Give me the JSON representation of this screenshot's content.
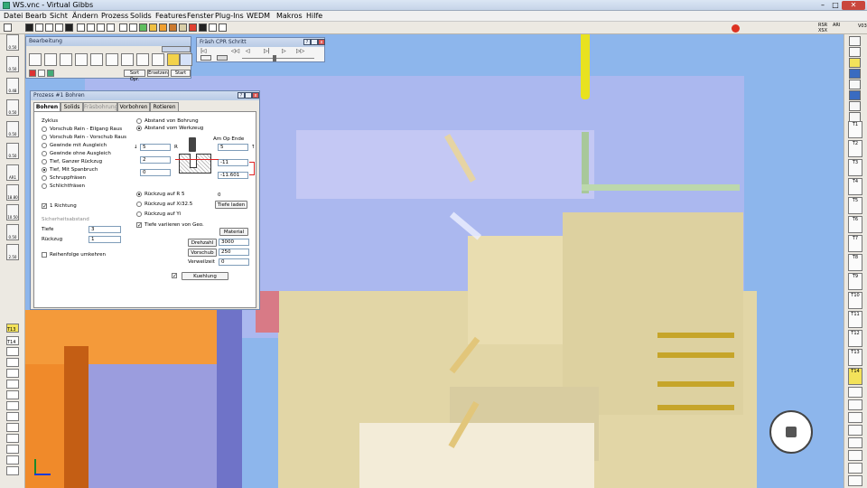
{
  "window": {
    "title": "WS.vnc - Virtual Gibbs",
    "minimize": "–",
    "maximize": "□",
    "close": "✕"
  },
  "menu": [
    "Datei",
    "Bearb",
    "Sicht",
    "Ändern",
    "Prozess",
    "Solids",
    "Features",
    "Fenster",
    "Plug-Ins",
    "WEDM",
    "Makros",
    "Hilfe"
  ],
  "toolbar": {
    "rsr": "RSR\nXSX",
    "arl": "ARI",
    "v": "V03"
  },
  "bearbeitung": {
    "title": "Bearbeitung",
    "buttons": [
      "Sort Opr.",
      "Ersetzen",
      "Start"
    ]
  },
  "cpr": {
    "title": "Fräsh CPR Schritt"
  },
  "prozess": {
    "title": "Prozess #1 Bohren",
    "tabs": [
      "Bohren",
      "Solids",
      "Fräsbohrung",
      "Vorbohren",
      "Rotieren"
    ],
    "zyklus_label": "Zyklus",
    "zyklus": [
      "Vorschub Rein - Eilgang Raus",
      "Vorschub Rein - Vorschub Raus",
      "Gewinde mit Ausgleich",
      "Gewinde ohne Ausgleich",
      "Tief, Ganzer Rückzug",
      "Tief, Mit Spanbruch",
      "Schruppfräsen",
      "Schlichtfräsen"
    ],
    "zyklus_selected": 5,
    "abstand": [
      "Abstand von Bohrung",
      "Abstand vom Werkzeug"
    ],
    "abstand_selected": 1,
    "am_op_ende": "Am Op Ende",
    "geo_left": [
      "5",
      "2",
      "0"
    ],
    "geo_r": "R",
    "geo_right": [
      "5",
      "-11",
      "-11.601"
    ],
    "richtung": "1 Richtung",
    "sicherheit_label": "Sicherheitsabstand",
    "tiefe_label": "Tiefe",
    "tiefe_value": "3",
    "ruckzug_label": "Rückzug",
    "ruckzug_value": "1",
    "reihenfolge": "Reihenfolge umkehren",
    "ruckzug_opts": [
      {
        "label": "Rückzug auf R",
        "value": "5"
      },
      {
        "label": "Rückzug auf Xi",
        "value": "32.5"
      },
      {
        "label": "Rückzug auf Yi",
        "value": ""
      }
    ],
    "zero_value": "0",
    "tiefe_laden": "Tiefe laden",
    "tiefe_variieren": "Tiefe variieren von Geo.",
    "material": "Material",
    "drehzahl_btn": "Drehzahl",
    "drehzahl_value": "3000",
    "vorschub_btn": "Vorschub",
    "vorschub_value": "250",
    "verweilzeit_label": "Verweilzeit",
    "verweilzeit_value": "0",
    "kuhlung": "Kuehlung"
  },
  "left_tools": [
    "0.50",
    "0.50",
    "0.48",
    "0.50",
    "0.50",
    "0.50",
    "AR1",
    "18.80",
    "10.50",
    "0.50",
    "2.50"
  ],
  "right_tools": [
    "T1",
    "T2",
    "T3",
    "T4",
    "T5",
    "T6",
    "T7",
    "T8",
    "T9",
    "T10",
    "T11",
    "T12",
    "T13",
    "T14"
  ],
  "left_tools_b": [
    "T13",
    "T14"
  ]
}
